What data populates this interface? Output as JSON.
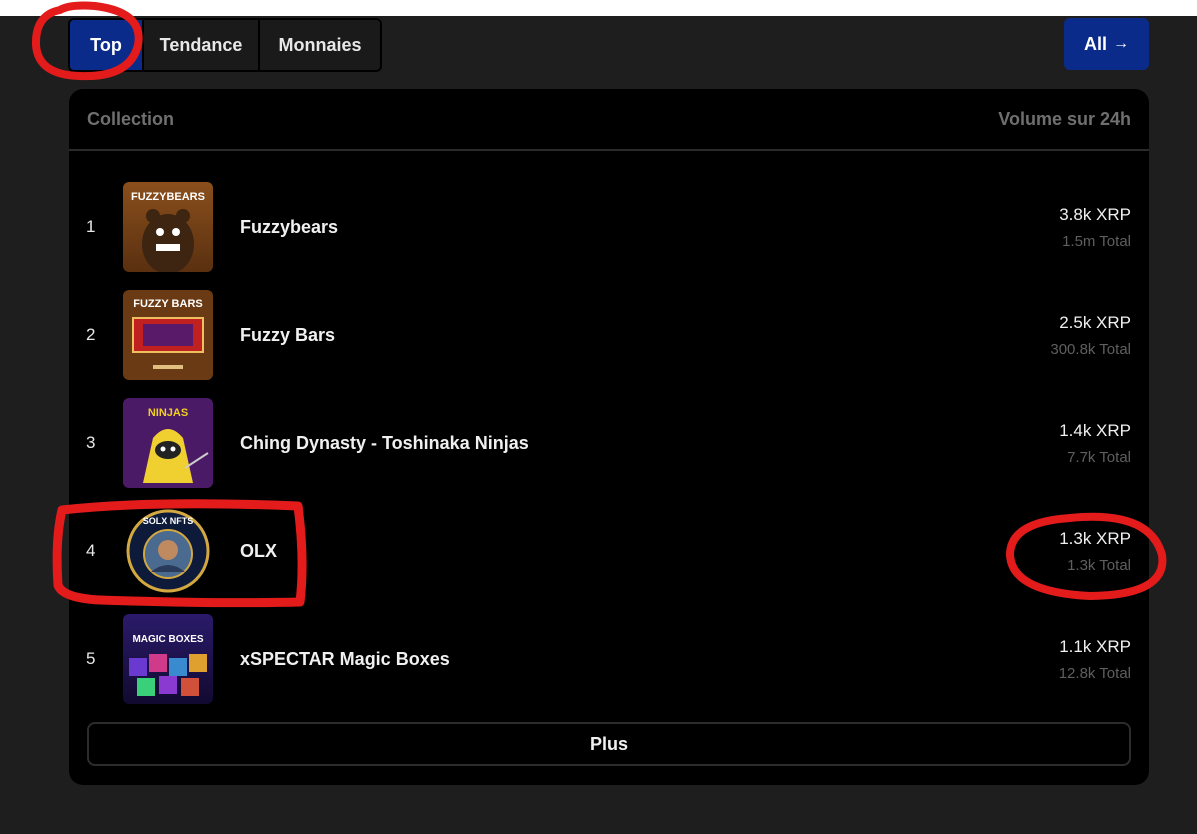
{
  "tabs": [
    {
      "label": "Top",
      "active": true
    },
    {
      "label": "Tendance",
      "active": false
    },
    {
      "label": "Monnaies",
      "active": false
    }
  ],
  "all_button": {
    "label": "All",
    "icon": "arrow-right-icon"
  },
  "table": {
    "col_collection": "Collection",
    "col_volume": "Volume sur 24h",
    "rows": [
      {
        "rank": "1",
        "name": "Fuzzybears",
        "volume": "3.8k XRP",
        "total": "1.5m Total",
        "thumb_text": "FUZZYBEARS"
      },
      {
        "rank": "2",
        "name": "Fuzzy Bars",
        "volume": "2.5k XRP",
        "total": "300.8k Total",
        "thumb_text": "FUZZY BARS"
      },
      {
        "rank": "3",
        "name": "Ching Dynasty - Toshinaka Ninjas",
        "volume": "1.4k XRP",
        "total": "7.7k Total",
        "thumb_text": "NINJAS"
      },
      {
        "rank": "4",
        "name": "OLX",
        "volume": "1.3k XRP",
        "total": "1.3k Total",
        "thumb_text": "SOLX NFTS"
      },
      {
        "rank": "5",
        "name": "xSPECTAR Magic Boxes",
        "volume": "1.1k XRP",
        "total": "12.8k Total",
        "thumb_text": "MAGIC BOXES"
      }
    ]
  },
  "more_button": "Plus",
  "colors": {
    "accent": "#0a2b8a",
    "annotation": "#e31b1b",
    "background": "#1e1e1e"
  }
}
